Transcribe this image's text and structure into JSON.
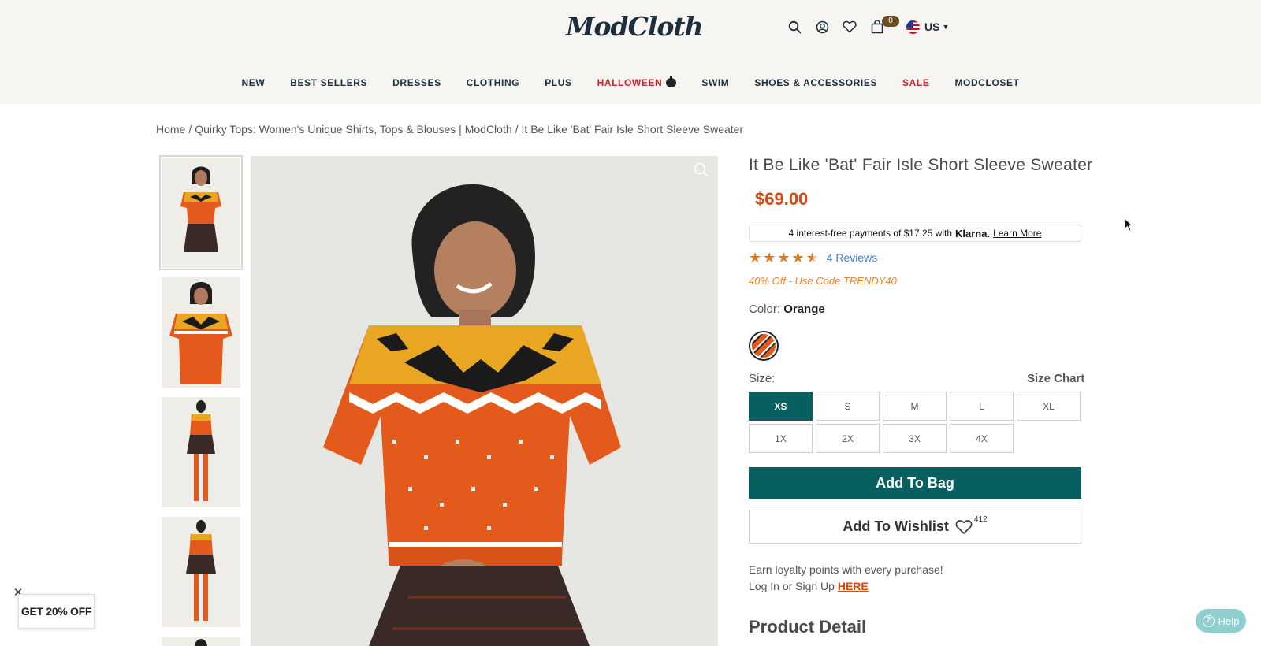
{
  "header": {
    "logo": "ModCloth",
    "bag_count": "0",
    "locale": "US",
    "icons": [
      "search-icon",
      "account-icon",
      "heart-icon",
      "bag-icon"
    ]
  },
  "nav": [
    {
      "label": "NEW"
    },
    {
      "label": "BEST SELLERS"
    },
    {
      "label": "DRESSES"
    },
    {
      "label": "CLOTHING"
    },
    {
      "label": "PLUS"
    },
    {
      "label": "HALLOWEEN"
    },
    {
      "label": "SWIM"
    },
    {
      "label": "SHOES & ACCESSORIES"
    },
    {
      "label": "SALE"
    },
    {
      "label": "MODCLOSET"
    }
  ],
  "breadcrumb": {
    "home": "Home",
    "category": "Quirky Tops: Women's Unique Shirts, Tops & Blouses | ModCloth",
    "current": "It Be Like 'Bat' Fair Isle Short Sleeve Sweater"
  },
  "product": {
    "title": "It Be Like 'Bat' Fair Isle Short Sleeve Sweater",
    "price": "$69.00",
    "klarna": {
      "text": "4 interest-free payments of $17.25 with",
      "brand": "Klarna.",
      "link": "Learn More"
    },
    "rating": 4.5,
    "reviews": "4 Reviews",
    "promo": "40% Off - Use Code TRENDY40",
    "color_label": "Color:",
    "color_value": "Orange",
    "size_label": "Size:",
    "size_chart": "Size Chart",
    "sizes": [
      "XS",
      "S",
      "M",
      "L",
      "XL",
      "1X",
      "2X",
      "3X",
      "4X"
    ],
    "selected_size": "XS",
    "add_to_bag": "Add To Bag",
    "add_to_wishlist": "Add To Wishlist",
    "wishlist_count": "412",
    "loyalty_line1": "Earn loyalty points with every purchase!",
    "loyalty_line2": "Log In or Sign Up",
    "loyalty_link": "HERE",
    "detail_heading": "Product Detail"
  },
  "widgets": {
    "promo_popup": "GET 20% OFF",
    "close": "✕",
    "help": "Help"
  },
  "colors": {
    "accent": "#075f5f",
    "price": "#d9480f",
    "sale": "#c1272d",
    "promo": "#e8862a",
    "star": "#e07a1f",
    "link": "#3a7bd5"
  }
}
